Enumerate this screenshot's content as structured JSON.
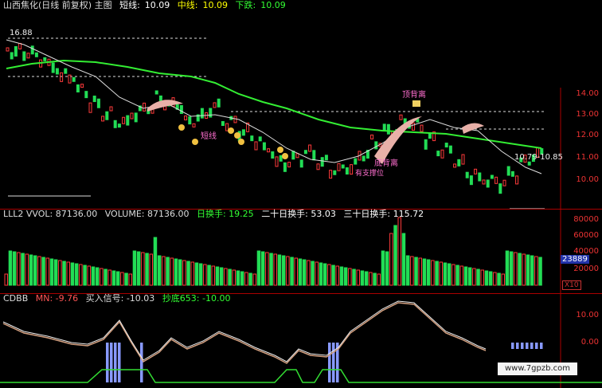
{
  "price_header": {
    "title": "山西焦化(日线 前复权) 主图",
    "short_label": "短线:",
    "short_val": "10.09",
    "mid_label": "中线:",
    "mid_val": "10.09",
    "down_label": "下跌:",
    "down_val": "10.09"
  },
  "price_axis": [
    "14.00",
    "13.00",
    "12.00",
    "11.00",
    "10.00"
  ],
  "price_labels": {
    "high": "16.88",
    "range": "10.79-10.85",
    "top_div": "顶背离",
    "bottom_div": "底背离",
    "short": "短线",
    "bottom_text": "有支撑位"
  },
  "vol_header": {
    "name": "LLL2 VVOL: 87136.00",
    "volume": "VOLUME: 87136.00",
    "t10": "日换手: 19.25",
    "t20": "二十日换手: 53.03",
    "t30": "三十日换手: 115.72"
  },
  "vol_axis": [
    "80000",
    "60000",
    "40000",
    "20000"
  ],
  "vol_current": "23889",
  "vol_unit": "X10",
  "ind_header": {
    "name": "CDBB",
    "mn": "MN: -9.76",
    "buy": "买入信号: -10.03",
    "bottom": "抄底653: -10.00"
  },
  "ind_axis": [
    "10.00",
    "0.00"
  ],
  "watermark": "www.7gpzb.com",
  "colors": {
    "up": "#ff3b3b",
    "down": "#22dd55",
    "ma": "#33ee33",
    "bg": "#000000"
  }
}
